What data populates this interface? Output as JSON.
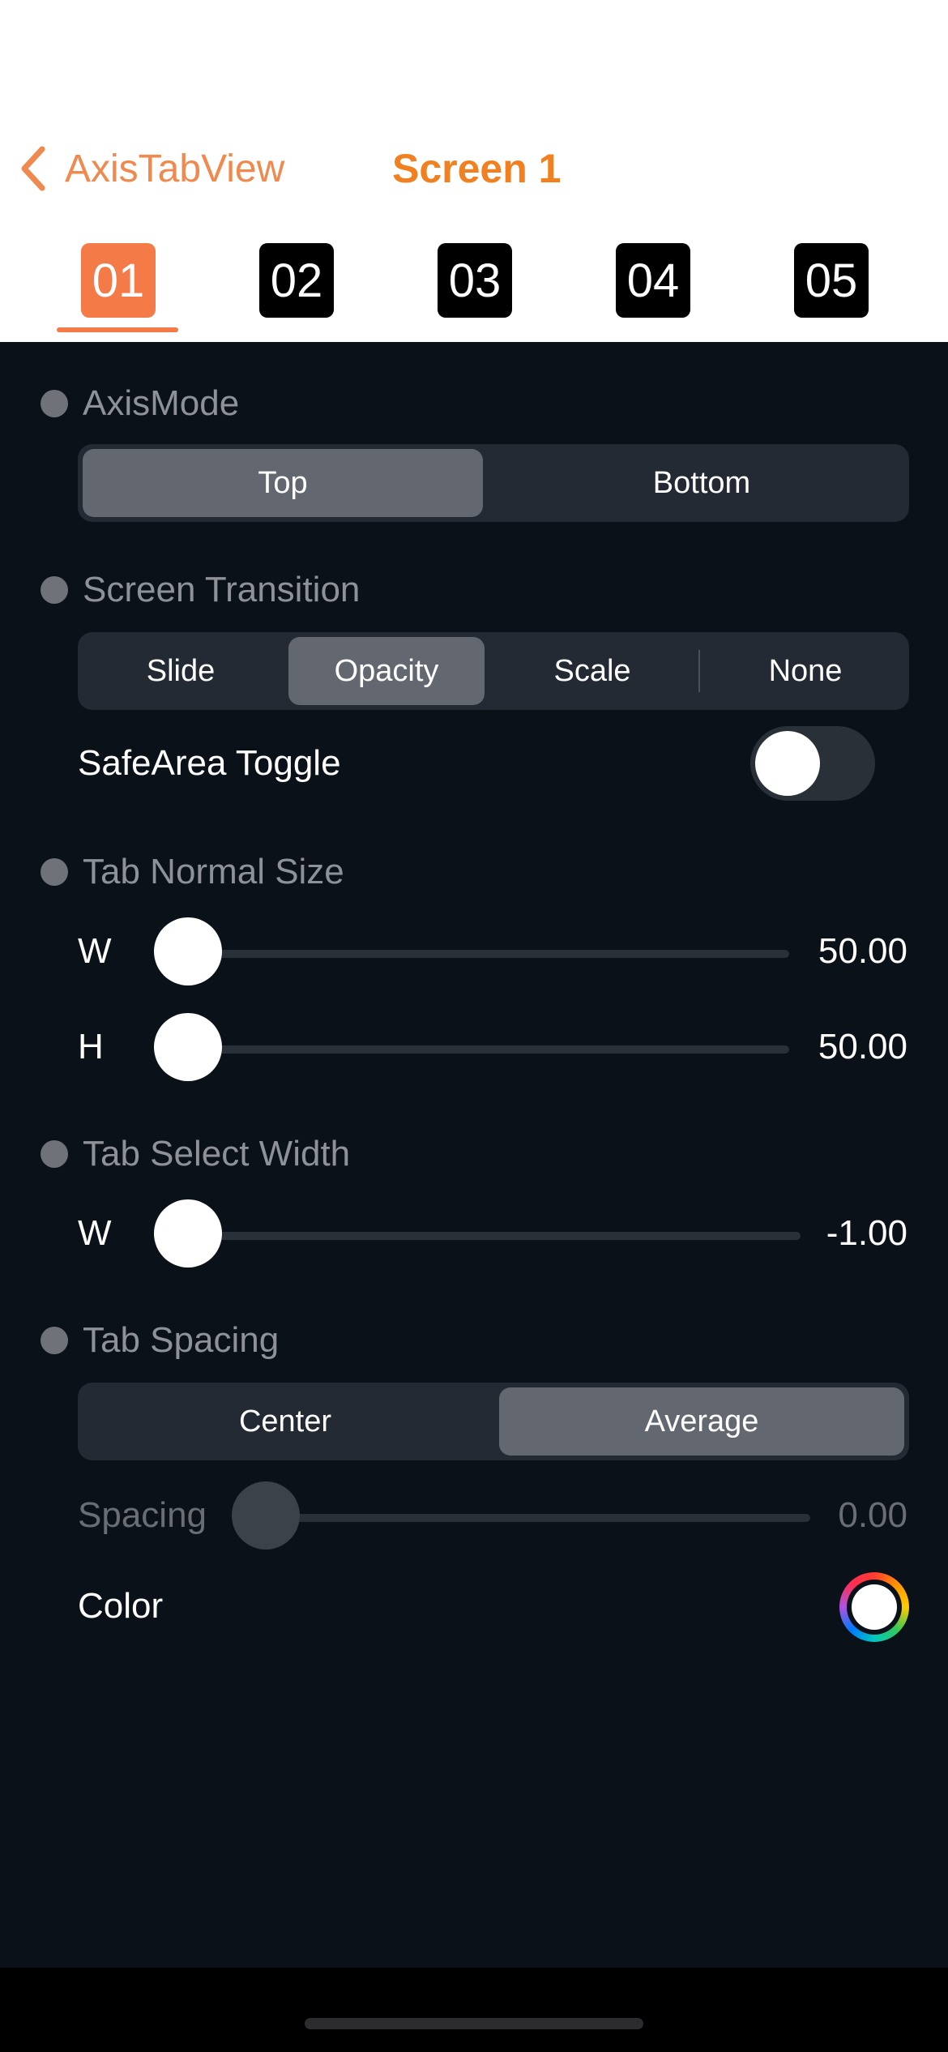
{
  "nav": {
    "back_label": "AxisTabView",
    "title": "Screen 1"
  },
  "tabs": [
    {
      "label": "01",
      "selected": true
    },
    {
      "label": "02",
      "selected": false
    },
    {
      "label": "03",
      "selected": false
    },
    {
      "label": "04",
      "selected": false
    },
    {
      "label": "05",
      "selected": false
    }
  ],
  "axis_mode": {
    "title": "AxisMode",
    "options": [
      "Top",
      "Bottom"
    ],
    "selected": "Top"
  },
  "screen_transition": {
    "title": "Screen Transition",
    "options": [
      "Slide",
      "Opacity",
      "Scale",
      "None"
    ],
    "selected": "Opacity",
    "safearea_label": "SafeArea Toggle",
    "safearea_on": false
  },
  "tab_normal_size": {
    "title": "Tab Normal Size",
    "w_label": "W",
    "w_value": "50.00",
    "h_label": "H",
    "h_value": "50.00"
  },
  "tab_select_width": {
    "title": "Tab Select Width",
    "w_label": "W",
    "w_value": "-1.00"
  },
  "tab_spacing": {
    "title": "Tab Spacing",
    "options": [
      "Center",
      "Average"
    ],
    "selected": "Average",
    "spacing_label": "Spacing",
    "spacing_value": "0.00",
    "color_label": "Color",
    "color_value": "#ffffff"
  },
  "colors": {
    "accent": "#f47a48",
    "nav_tint": "#f08020",
    "background": "#0b1119"
  }
}
